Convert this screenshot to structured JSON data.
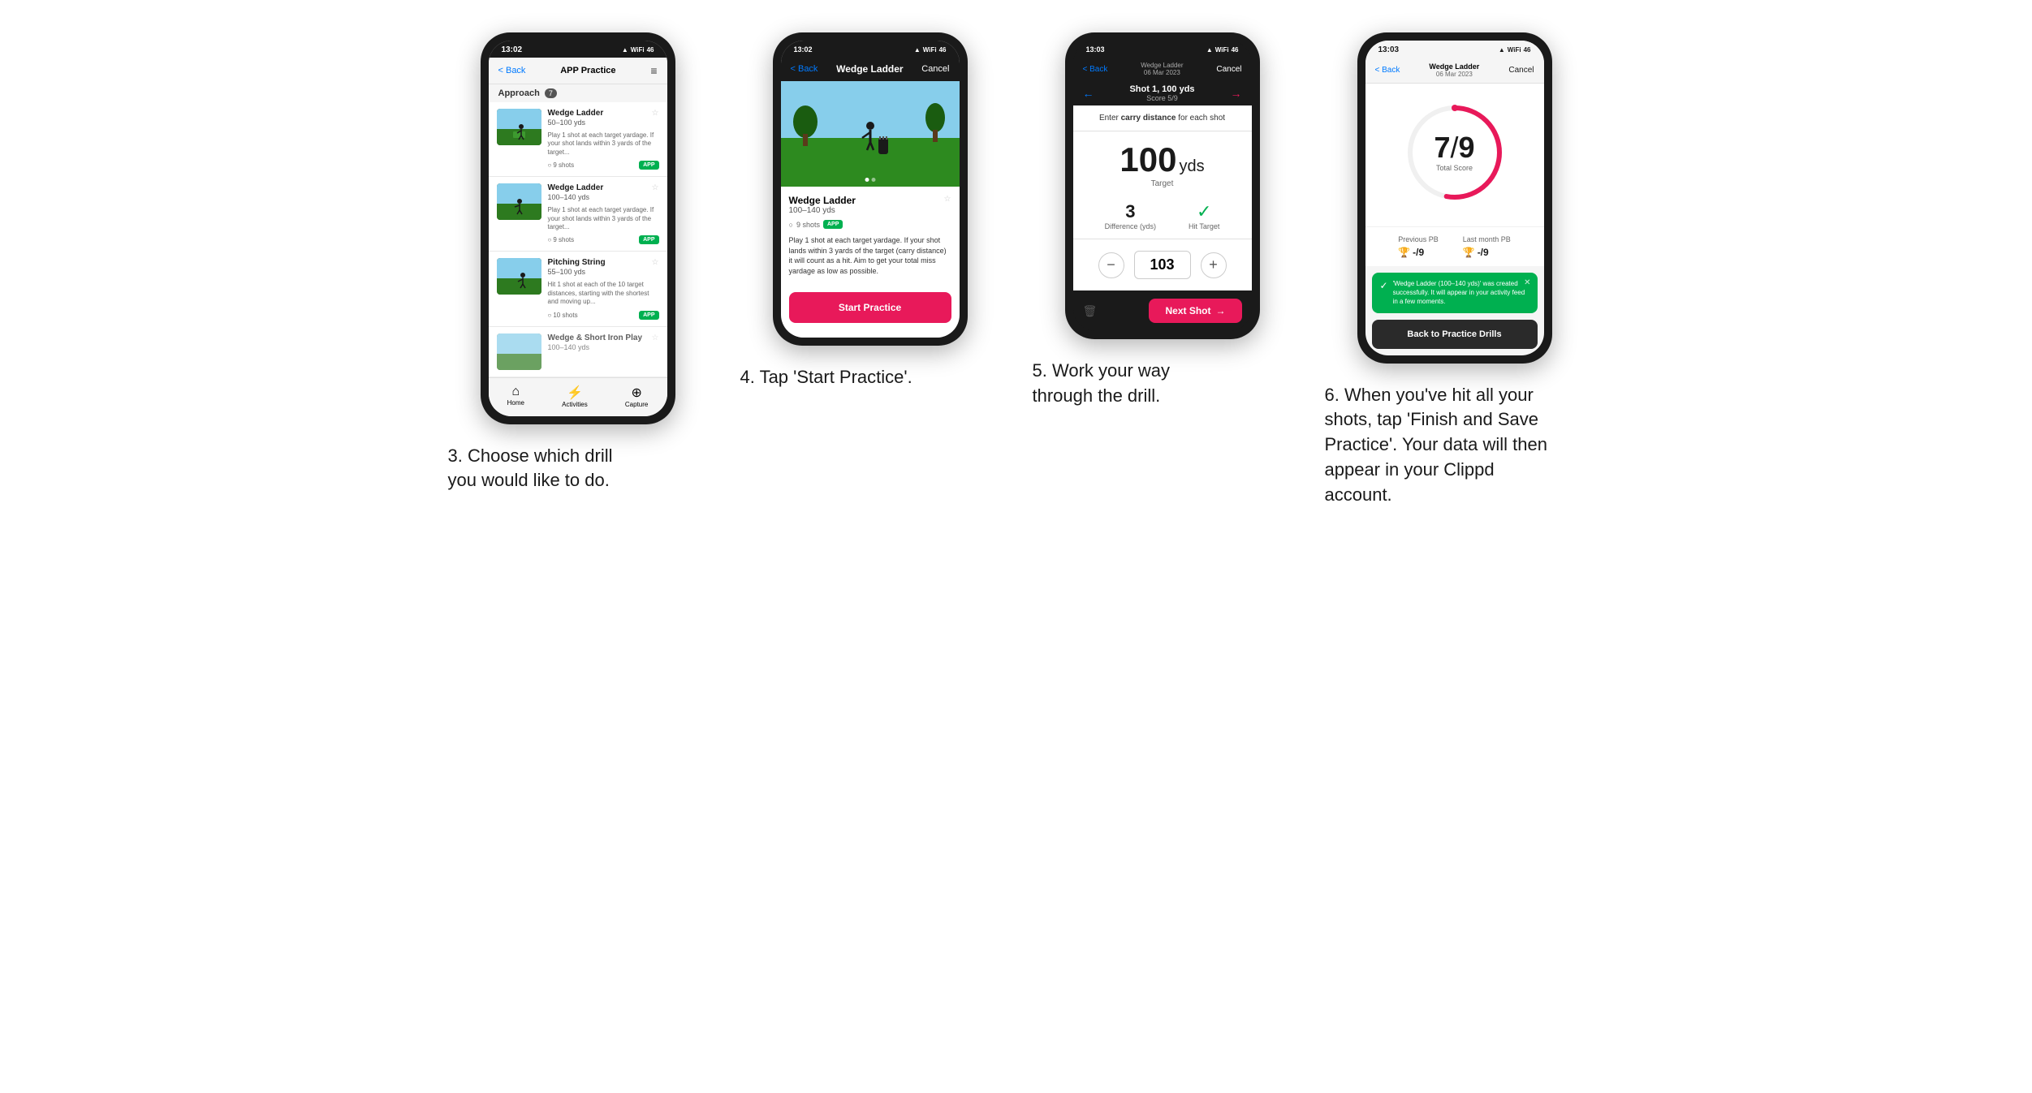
{
  "phones": [
    {
      "id": "phone1",
      "status": {
        "time": "13:02",
        "icons": "▲ ⓦ 46"
      },
      "nav": {
        "back": "< Back",
        "title": "APP Practice",
        "menu": "≡"
      },
      "section": {
        "label": "Approach",
        "count": "7"
      },
      "drills": [
        {
          "title": "Wedge Ladder",
          "range": "50–100 yds",
          "desc": "Play 1 shot at each target yardage. If your shot lands within 3 yards of the target...",
          "shots": "9 shots",
          "badge": "APP"
        },
        {
          "title": "Wedge Ladder",
          "range": "100–140 yds",
          "desc": "Play 1 shot at each target yardage. If your shot lands within 3 yards of the target...",
          "shots": "9 shots",
          "badge": "APP"
        },
        {
          "title": "Pitching String",
          "range": "55–100 yds",
          "desc": "Hit 1 shot at each of the 10 target distances, starting with the shortest and moving up...",
          "shots": "10 shots",
          "badge": "APP"
        },
        {
          "title": "Wedge & Short Iron Play",
          "range": "100–140 yds",
          "desc": "",
          "shots": "",
          "badge": ""
        }
      ],
      "bottomNav": {
        "home": "Home",
        "activities": "Activities",
        "capture": "Capture"
      }
    },
    {
      "id": "phone2",
      "status": {
        "time": "13:02",
        "icons": "▲ ⓦ 46"
      },
      "nav": {
        "back": "< Back",
        "title": "Wedge Ladder",
        "cancel": "Cancel"
      },
      "drill": {
        "title": "Wedge Ladder",
        "range": "100–140 yds",
        "shots": "9 shots",
        "badge": "APP",
        "desc": "Play 1 shot at each target yardage. If your shot lands within 3 yards of the target (carry distance) it will count as a hit. Aim to get your total miss yardage as low as possible."
      },
      "startButton": "Start Practice"
    },
    {
      "id": "phone3",
      "status": {
        "time": "13:03",
        "icons": "▲ ⓦ 46"
      },
      "nav": {
        "back": "< Back",
        "drillTitle": "Wedge Ladder",
        "drillDate": "06 Mar 2023",
        "cancel": "Cancel"
      },
      "shotNav": {
        "shotLabel": "Shot 1, 100 yds",
        "score": "Score 5/9"
      },
      "instruction": "Enter carry distance for each shot",
      "target": {
        "value": "100",
        "unit": "yds",
        "label": "Target"
      },
      "stats": {
        "difference": {
          "value": "3",
          "label": "Difference (yds)"
        },
        "hitTarget": {
          "value": "✓",
          "label": "Hit Target"
        }
      },
      "inputValue": "103",
      "nextShotButton": "Next Shot"
    },
    {
      "id": "phone4",
      "status": {
        "time": "13:03",
        "icons": "▲ ⓦ 46"
      },
      "nav": {
        "back": "< Back",
        "drillTitle": "Wedge Ladder",
        "drillDate": "06 Mar 2023",
        "cancel": "Cancel"
      },
      "score": {
        "value": "7",
        "total": "9",
        "label": "Total Score"
      },
      "previousPB": {
        "label": "Previous PB",
        "value": "-/9"
      },
      "lastMonthPB": {
        "label": "Last month PB",
        "value": "-/9"
      },
      "toast": {
        "message": "'Wedge Ladder (100–140 yds)' was created successfully. It will appear in your activity feed in a few moments."
      },
      "backButton": "Back to Practice Drills"
    }
  ],
  "captions": [
    "3. Choose which drill you would like to do.",
    "4. Tap 'Start Practice'.",
    "5. Work your way through the drill.",
    "6. When you've hit all your shots, tap 'Finish and Save Practice'. Your data will then appear in your Clippd account."
  ]
}
